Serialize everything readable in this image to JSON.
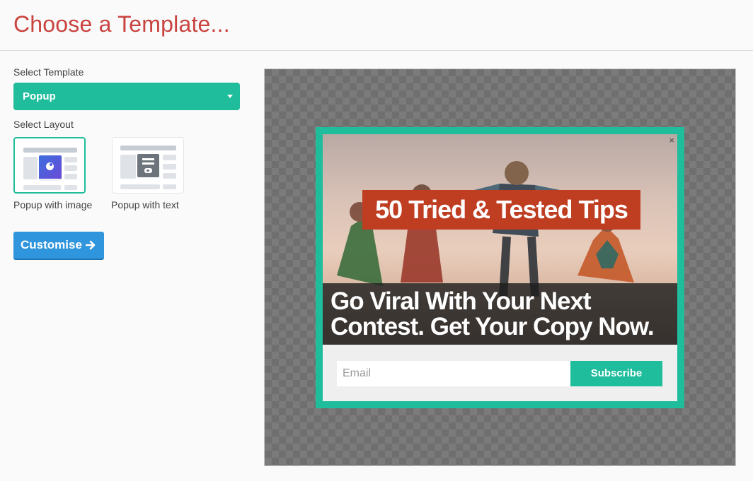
{
  "header": {
    "title": "Choose a Template..."
  },
  "sidebar": {
    "select_template_label": "Select Template",
    "template_value": "Popup",
    "select_layout_label": "Select Layout",
    "layouts": [
      {
        "label": "Popup with image",
        "selected": true
      },
      {
        "label": "Popup with text",
        "selected": false
      }
    ],
    "customise_label": "Customise"
  },
  "preview": {
    "close_symbol": "×",
    "headline": "50 Tried & Tested Tips",
    "subheadline_line1": "Go Viral With Your Next",
    "subheadline_line2": "Contest. Get Your Copy Now.",
    "email_placeholder": "Email",
    "subscribe_label": "Subscribe"
  },
  "colors": {
    "accent": "#1fbd9c",
    "title": "#c9433f",
    "primary_button": "#2f95dc",
    "banner_orange": "#bf3d21"
  },
  "icons": [
    "caret-down-icon",
    "arrow-right-icon",
    "close-icon",
    "image-icon",
    "text-icon"
  ]
}
